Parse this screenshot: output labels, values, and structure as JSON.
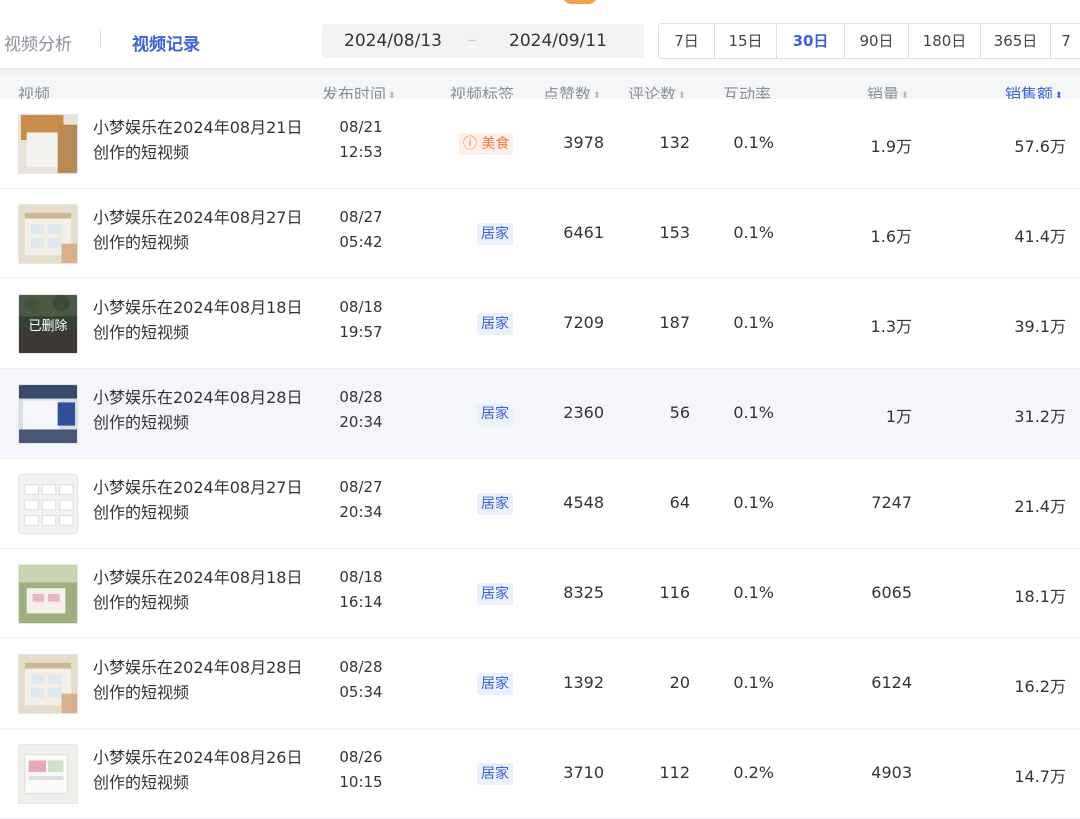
{
  "nav": {
    "tab_analysis": "视频分析",
    "tab_records": "视频记录"
  },
  "date_range": {
    "start": "2024/08/13",
    "separator": "–",
    "end": "2024/09/11"
  },
  "periods": [
    {
      "label": "7日",
      "active": false
    },
    {
      "label": "15日",
      "active": false
    },
    {
      "label": "30日",
      "active": true
    },
    {
      "label": "90日",
      "active": false
    },
    {
      "label": "180日",
      "active": false
    },
    {
      "label": "365日",
      "active": false
    },
    {
      "label": "7",
      "active": false
    }
  ],
  "columns": {
    "video": "视频",
    "publish_time": "发布时间",
    "tag": "视频标签",
    "likes": "点赞数",
    "comments": "评论数",
    "interaction_rate": "互动率",
    "sales": "销量",
    "revenue": "销售额"
  },
  "sort_glyph": "⬍",
  "rows": [
    {
      "title": "小梦娱乐在2024年08月21日创作的短视频",
      "date": "08/21",
      "time": "12:53",
      "tag": "美食",
      "tag_type": "food",
      "tag_icon": "ⓘ",
      "likes": "3978",
      "comments": "132",
      "rate": "0.1%",
      "sales": "1.9万",
      "revenue": "57.6万",
      "deleted": false,
      "thumb_style": "cardboard"
    },
    {
      "title": "小梦娱乐在2024年08月27日创作的短视频",
      "date": "08/27",
      "time": "05:42",
      "tag": "居家",
      "tag_type": "home",
      "likes": "6461",
      "comments": "153",
      "rate": "0.1%",
      "sales": "1.6万",
      "revenue": "41.4万",
      "deleted": false,
      "thumb_style": "box"
    },
    {
      "title": "小梦娱乐在2024年08月18日创作的短视频",
      "date": "08/18",
      "time": "19:57",
      "tag": "居家",
      "tag_type": "home",
      "likes": "7209",
      "comments": "187",
      "rate": "0.1%",
      "sales": "1.3万",
      "revenue": "39.1万",
      "deleted": true,
      "deleted_label": "已删除",
      "thumb_style": "green"
    },
    {
      "title": "小梦娱乐在2024年08月28日创作的短视频",
      "date": "08/28",
      "time": "20:34",
      "tag": "居家",
      "tag_type": "home",
      "likes": "2360",
      "comments": "56",
      "rate": "0.1%",
      "sales": "1万",
      "revenue": "31.2万",
      "deleted": false,
      "thumb_style": "blue",
      "highlighted": true
    },
    {
      "title": "小梦娱乐在2024年08月27日创作的短视频",
      "date": "08/27",
      "time": "20:34",
      "tag": "居家",
      "tag_type": "home",
      "likes": "4548",
      "comments": "64",
      "rate": "0.1%",
      "sales": "7247",
      "revenue": "21.4万",
      "deleted": false,
      "thumb_style": "white"
    },
    {
      "title": "小梦娱乐在2024年08月18日创作的短视频",
      "date": "08/18",
      "time": "16:14",
      "tag": "居家",
      "tag_type": "home",
      "likes": "8325",
      "comments": "116",
      "rate": "0.1%",
      "sales": "6065",
      "revenue": "18.1万",
      "deleted": false,
      "thumb_style": "outdoor"
    },
    {
      "title": "小梦娱乐在2024年08月28日创作的短视频",
      "date": "08/28",
      "time": "05:34",
      "tag": "居家",
      "tag_type": "home",
      "likes": "1392",
      "comments": "20",
      "rate": "0.1%",
      "sales": "6124",
      "revenue": "16.2万",
      "deleted": false,
      "thumb_style": "box"
    },
    {
      "title": "小梦娱乐在2024年08月26日创作的短视频",
      "date": "08/26",
      "time": "10:15",
      "tag": "居家",
      "tag_type": "home",
      "likes": "3710",
      "comments": "112",
      "rate": "0.2%",
      "sales": "4903",
      "revenue": "14.7万",
      "deleted": false,
      "thumb_style": "pink"
    }
  ]
}
